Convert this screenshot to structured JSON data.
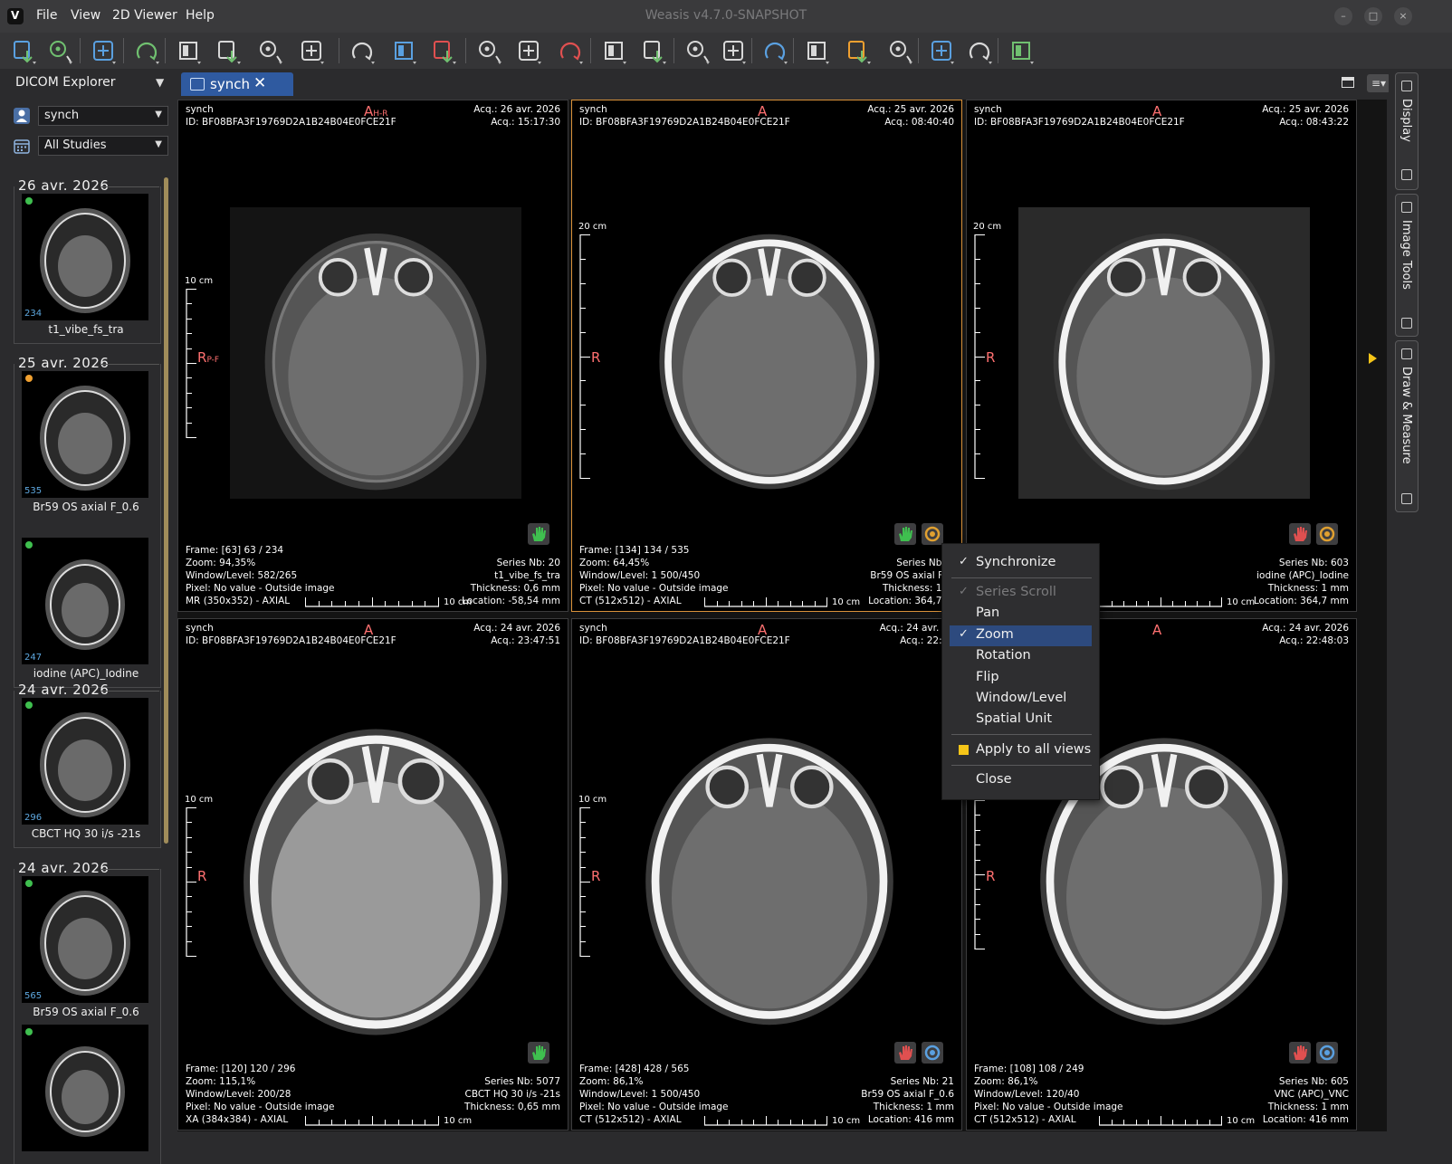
{
  "app": {
    "title": "Weasis v4.7.0-SNAPSHOT",
    "menu": [
      "File",
      "View",
      "2D Viewer",
      "Help"
    ],
    "window_controls": [
      "–",
      "□",
      "×"
    ]
  },
  "toolbar": {
    "icons": [
      "import-dicom-icon",
      "import-cd-icon",
      "export-dicom-icon",
      "export-image-icon",
      "mouse-zoom-icon",
      "mouse-select-icon",
      "mouse-scroll-icon",
      "mouse-pan-icon",
      "layout-icon",
      "synch-icon",
      "reset-icon",
      "crosshair-select-icon",
      "measure-select-icon",
      "delete-measure-icon",
      "zoom-icon",
      "pan-icon",
      "rotate-icon",
      "flip-icon",
      "cine-icon",
      "window-level-icon",
      "lut-icon",
      "invert-icon",
      "mpr-icon",
      "tools-icon",
      "3d-icon"
    ]
  },
  "explorer": {
    "title": "DICOM Explorer",
    "menu_arrow": "▼",
    "patient_combo": "synch",
    "studies_combo": "All Studies",
    "studies": [
      {
        "date": "26 avr. 2026",
        "series": [
          {
            "count": "234",
            "label": "t1_vibe_fs_tra",
            "status": "green"
          }
        ]
      },
      {
        "date": "25 avr. 2026",
        "series": [
          {
            "count": "535",
            "label": "Br59 OS  axial  F_0.6",
            "status": "orange"
          },
          {
            "count": "247",
            "label": "iodine (APC)_Iodine",
            "status": "green"
          }
        ]
      },
      {
        "date": "24 avr. 2026",
        "series": [
          {
            "count": "296",
            "label": "CBCT HQ 30 i/s -21s",
            "status": "green"
          }
        ]
      },
      {
        "date": "24 avr. 2026",
        "series": [
          {
            "count": "565",
            "label": "Br59  OS axial  F_0.6",
            "status": "green"
          },
          {
            "count": "",
            "label": "",
            "status": "green"
          }
        ]
      }
    ]
  },
  "tab": {
    "label": "synch",
    "close": "✕"
  },
  "viewports": [
    {
      "tl": [
        "synch",
        "ID: BF08BFA3F19769D2A1B24B04E0FCE21F"
      ],
      "tr": [
        "Acq.: 26 avr. 2026",
        "Acq.: 15:17:30"
      ],
      "bl": [
        "Frame: [63] 63 / 234",
        "Zoom: 94,35%",
        "Window/Level: 582/265",
        "Pixel: No value - Outside image",
        "MR (350x352) - AXIAL"
      ],
      "br": [
        "Series Nb: 20",
        "t1_vibe_fs_tra",
        "Thickness: 0,6 mm",
        "Location: -58,54 mm"
      ],
      "orient_top": "A",
      "orient_top_sub": "H-R",
      "orient_left": "R",
      "orient_left_sub": "P-F",
      "ruler_v": "10 cm",
      "ruler_h": "10 cm"
    },
    {
      "tl": [
        "synch",
        "ID: BF08BFA3F19769D2A1B24B04E0FCE21F"
      ],
      "tr": [
        "Acq.: 25 avr. 2026",
        "Acq.: 08:40:40"
      ],
      "bl": [
        "Frame: [134] 134 / 535",
        "Zoom: 64,45%",
        "Window/Level: 1 500/450",
        "Pixel: No value - Outside image",
        "CT (512x512) - AXIAL"
      ],
      "br": [
        "Series Nb: 2",
        "Br59 OS  axial  F_0",
        "Thickness: 1 m",
        "Location: 364,7 m"
      ],
      "orient_top": "A",
      "orient_top_sub": "",
      "orient_left": "R",
      "orient_left_sub": "",
      "ruler_v": "20 cm",
      "ruler_h": "10 cm"
    },
    {
      "tl": [
        "synch",
        "ID: BF08BFA3F19769D2A1B24B04E0FCE21F"
      ],
      "tr": [
        "Acq.: 25 avr. 2026",
        "Acq.: 08:43:22"
      ],
      "bl": [
        "",
        "",
        "",
        "age",
        ""
      ],
      "br": [
        "Series Nb: 603",
        "iodine (APC)_Iodine",
        "Thickness: 1 mm",
        "Location: 364,7 mm"
      ],
      "orient_top": "A",
      "orient_top_sub": "",
      "orient_left": "R",
      "orient_left_sub": "",
      "ruler_v": "20 cm",
      "ruler_h": "10 cm"
    },
    {
      "tl": [
        "synch",
        "ID: BF08BFA3F19769D2A1B24B04E0FCE21F"
      ],
      "tr": [
        "Acq.: 24 avr. 2026",
        "Acq.: 23:47:51"
      ],
      "bl": [
        "Frame: [120] 120 / 296",
        "Zoom: 115,1%",
        "Window/Level: 200/28",
        "Pixel: No value - Outside image",
        "XA (384x384) - AXIAL"
      ],
      "br": [
        "Series Nb: 5077",
        "CBCT HQ 30 i/s -21s",
        "Thickness: 0,65 mm",
        ""
      ],
      "orient_top": "A",
      "orient_top_sub": "",
      "orient_left": "R",
      "orient_left_sub": "",
      "ruler_v": "10 cm",
      "ruler_h": "10 cm"
    },
    {
      "tl": [
        "synch",
        "ID: BF08BFA3F19769D2A1B24B04E0FCE21F"
      ],
      "tr": [
        "Acq.: 24 avr. 20",
        "Acq.: 22:44"
      ],
      "bl": [
        "Frame: [428] 428 / 565",
        "Zoom: 86,1%",
        "Window/Level: 1 500/450",
        "Pixel: No value - Outside image",
        "CT (512x512) - AXIAL"
      ],
      "br": [
        "Series Nb: 21",
        "Br59  OS axial  F_0.6",
        "Thickness: 1 mm",
        "Location: 416 mm"
      ],
      "orient_top": "A",
      "orient_top_sub": "",
      "orient_left": "R",
      "orient_left_sub": "",
      "ruler_v": "10 cm",
      "ruler_h": "10 cm"
    },
    {
      "tl": [
        "",
        "24B04E0FCE21F"
      ],
      "tr": [
        "Acq.: 24 avr. 2026",
        "Acq.: 22:48:03"
      ],
      "bl": [
        "Frame: [108] 108 / 249",
        "Zoom: 86,1%",
        "Window/Level: 120/40",
        "Pixel: No value - Outside image",
        "CT (512x512) - AXIAL"
      ],
      "br": [
        "Series Nb: 605",
        "VNC (APC)_VNC",
        "Thickness: 1 mm",
        "Location: 416 mm"
      ],
      "orient_top": "A",
      "orient_top_sub": "",
      "orient_left": "R",
      "orient_left_sub": "",
      "ruler_v": "",
      "ruler_h": "10 cm"
    }
  ],
  "context_menu": {
    "items": [
      {
        "label": "Synchronize",
        "check": "✓",
        "state": "normal"
      },
      {
        "label": "Series Scroll",
        "check": "✓",
        "state": "disabled"
      },
      {
        "label": "Pan",
        "check": "",
        "state": "normal"
      },
      {
        "label": "Zoom",
        "check": "✓",
        "state": "active"
      },
      {
        "label": "Rotation",
        "check": "",
        "state": "normal"
      },
      {
        "label": "Flip",
        "check": "",
        "state": "normal"
      },
      {
        "label": "Window/Level",
        "check": "",
        "state": "normal"
      },
      {
        "label": "Spatial Unit",
        "check": "",
        "state": "normal"
      },
      {
        "label": "Apply to all views",
        "check": "",
        "state": "normal"
      },
      {
        "label": "Close",
        "check": "",
        "state": "normal"
      }
    ]
  },
  "right_dock": {
    "tabs": [
      "Display",
      "Image Tools",
      "Draw & Measure"
    ]
  },
  "colors": {
    "accent": "#2f5aa0",
    "selected_border": "#d9923a",
    "orient": "#ff7070",
    "green_status": "#3fbf4f",
    "orange_status": "#f0a030",
    "yellow": "#f5c518"
  }
}
